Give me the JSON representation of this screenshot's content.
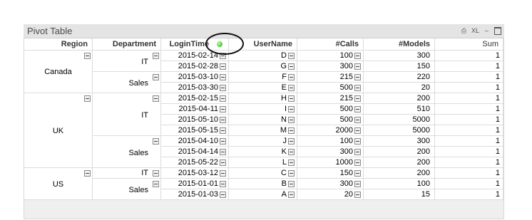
{
  "window": {
    "title": "Pivot Table",
    "buttons": [
      "⎙",
      "XL",
      "–",
      "□"
    ]
  },
  "columns": [
    "Region",
    "Department",
    "LoginTime",
    "UserName",
    "#Calls",
    "#Models",
    "Sum"
  ],
  "regions": [
    "Canada",
    "UK",
    "US"
  ],
  "departments": [
    "IT",
    "Sales",
    "IT",
    "Sales",
    "IT",
    "Sales"
  ],
  "rows": [
    {
      "login": "2015-02-14",
      "user": "D",
      "calls": "100",
      "models": "300",
      "sum": "1"
    },
    {
      "login": "2015-02-28",
      "user": "G",
      "calls": "300",
      "models": "150",
      "sum": "1"
    },
    {
      "login": "2015-03-10",
      "user": "F",
      "calls": "215",
      "models": "220",
      "sum": "1"
    },
    {
      "login": "2015-03-30",
      "user": "E",
      "calls": "500",
      "models": "20",
      "sum": "1"
    },
    {
      "login": "2015-02-15",
      "user": "H",
      "calls": "215",
      "models": "200",
      "sum": "1"
    },
    {
      "login": "2015-04-11",
      "user": "I",
      "calls": "500",
      "models": "510",
      "sum": "1"
    },
    {
      "login": "2015-05-10",
      "user": "N",
      "calls": "500",
      "models": "5000",
      "sum": "1"
    },
    {
      "login": "2015-05-15",
      "user": "M",
      "calls": "2000",
      "models": "5000",
      "sum": "1"
    },
    {
      "login": "2015-04-10",
      "user": "J",
      "calls": "100",
      "models": "300",
      "sum": "1"
    },
    {
      "login": "2015-04-14",
      "user": "K",
      "calls": "300",
      "models": "200",
      "sum": "1"
    },
    {
      "login": "2015-05-22",
      "user": "L",
      "calls": "1000",
      "models": "200",
      "sum": "1"
    },
    {
      "login": "2015-03-12",
      "user": "C",
      "calls": "150",
      "models": "200",
      "sum": "1"
    },
    {
      "login": "2015-01-01",
      "user": "B",
      "calls": "300",
      "models": "100",
      "sum": "1"
    },
    {
      "login": "2015-01-03",
      "user": "A",
      "calls": "20",
      "models": "15",
      "sum": "1"
    }
  ],
  "colors": {
    "grid_line": "#dcdcdc",
    "caption_bg": "#e4e4e4",
    "sort_indicator": "#1fae10"
  }
}
